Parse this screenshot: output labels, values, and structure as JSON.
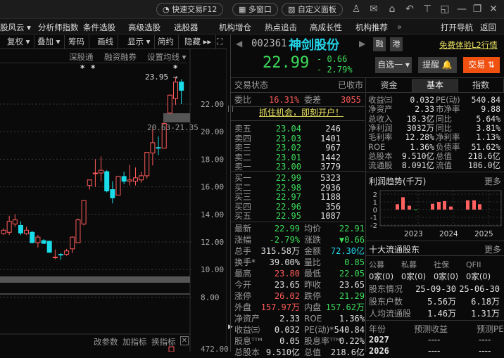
{
  "titlebar": {
    "quick_trade": "快速交易F12",
    "multi_window": "多窗口",
    "custom_panel": "自定义面板"
  },
  "menu": [
    "股风云 ▾",
    "分析师指数",
    "条件选股",
    "高级选股",
    "选股器",
    "机构增仓",
    "热点追击",
    "高成长性",
    "机构推荐",
    "»",
    "打开导航",
    "返回"
  ],
  "toolbar": [
    "复权 ▾",
    "叠加 ▾",
    "筹码",
    "画线",
    "显示 ▾",
    "简约",
    "隐藏 ▸▸"
  ],
  "chart_links": [
    "深股通",
    "融资融券",
    "设置均线 ▾"
  ],
  "chart": {
    "price_ticks": [
      "22.00",
      "20.00",
      "18.00",
      "16.00",
      "14.00",
      "12.00",
      "10.00",
      "8.00"
    ],
    "tick_values": [
      22,
      20,
      18,
      16,
      14,
      12,
      10,
      8
    ],
    "high_label": "23.95 →",
    "range_label": "20.63-21.35",
    "markers": [
      "*",
      "*",
      "*"
    ],
    "candles": [
      [
        12.6,
        12.85,
        13.0,
        12.5
      ],
      [
        12.7,
        13.5,
        13.9,
        12.5
      ],
      [
        13.3,
        13.6,
        14.0,
        13.1
      ],
      [
        13.2,
        12.65,
        13.5,
        12.5
      ],
      [
        12.6,
        12.85,
        13.1,
        12.5
      ],
      [
        12.7,
        11.95,
        12.8,
        11.9
      ],
      [
        11.95,
        12.35,
        12.5,
        11.6
      ],
      [
        12.1,
        11.9,
        12.2,
        11.85
      ],
      [
        12.05,
        11.25,
        12.1,
        11.2
      ],
      [
        10.85,
        10.9,
        11.45,
        10.75
      ],
      [
        11.1,
        11.05,
        11.2,
        10.7
      ],
      [
        11.1,
        11.35,
        11.5,
        11.0
      ],
      [
        11.5,
        12.35,
        12.4,
        11.2
      ],
      [
        11.95,
        13.6,
        13.7,
        11.95
      ],
      [
        13.3,
        15.0,
        15.0,
        13.2
      ],
      [
        16.1,
        16.5,
        16.5,
        15.8
      ],
      [
        16.95,
        17.0,
        18.0,
        16.0
      ],
      [
        17.0,
        17.2,
        18.2,
        16.4
      ],
      [
        17.1,
        15.7,
        17.2,
        15.6
      ],
      [
        15.8,
        15.2,
        16.4,
        14.8
      ],
      [
        15.4,
        16.75,
        16.8,
        15.4
      ],
      [
        16.75,
        16.4,
        17.1,
        16.2
      ],
      [
        16.4,
        16.5,
        17.6,
        16.1
      ],
      [
        16.4,
        16.65,
        17.4,
        16.1
      ],
      [
        16.5,
        16.8,
        17.1,
        16.3
      ],
      [
        16.8,
        18.5,
        18.5,
        16.6
      ],
      [
        18.45,
        19.2,
        20.4,
        17.55
      ],
      [
        18.85,
        18.8,
        19.65,
        18.3
      ],
      [
        18.8,
        20.6,
        20.65,
        18.8
      ],
      [
        21.35,
        22.65,
        22.7,
        21.3
      ],
      [
        22.4,
        23.6,
        23.95,
        21.95
      ],
      [
        23.6,
        23.0,
        23.8,
        22.0
      ]
    ],
    "indicator_actions": [
      "改参数",
      "加指标",
      "换指标"
    ],
    "volume_tick": "472.00"
  },
  "stock": {
    "code": "002361",
    "name": "神剑股份",
    "tag_margin": "融",
    "tag_hk": "港",
    "l2_link": "免费体验L2行情",
    "price": "22.99",
    "change": "- 0.66",
    "change_pct": "- 2.79%",
    "watchlist": "自选一 ▾",
    "alert": "提醒 🔔",
    "trade": "交易 ⇅"
  },
  "status": {
    "label": "交易状态",
    "value": "已收市",
    "ratio_label": "委比",
    "ratio": "16.31%",
    "diff_label": "委差",
    "diff": "3055",
    "promo": "抓住机会，即刻开户！"
  },
  "asks": [
    [
      "卖五",
      "23.04",
      "246"
    ],
    [
      "卖四",
      "23.03",
      "1401"
    ],
    [
      "卖三",
      "23.02",
      "967"
    ],
    [
      "卖二",
      "23.01",
      "1442"
    ],
    [
      "卖一",
      "23.00",
      "3779"
    ]
  ],
  "bids": [
    [
      "买一",
      "22.99",
      "5323"
    ],
    [
      "买二",
      "22.98",
      "2936"
    ],
    [
      "买三",
      "22.97",
      "1188"
    ],
    [
      "买四",
      "22.96",
      "356"
    ],
    [
      "买五",
      "22.95",
      "1087"
    ]
  ],
  "stats": [
    [
      "最新",
      "22.99",
      "g",
      "均价",
      "22.91",
      "g"
    ],
    [
      "涨幅",
      "-2.79%",
      "g",
      "涨跌",
      "▼0.66",
      "g"
    ],
    [
      "总手",
      "315.58万",
      "w",
      "金额",
      "72.30亿",
      "c"
    ],
    [
      "换手*",
      "39.00%",
      "w",
      "量比",
      "0.85",
      "g"
    ],
    [
      "最高",
      "23.80",
      "r",
      "最低",
      "22.05",
      "g"
    ],
    [
      "今开",
      "23.65",
      "w",
      "昨收",
      "23.65",
      "w"
    ],
    [
      "涨停",
      "26.02",
      "r",
      "跌停",
      "21.29",
      "g"
    ],
    [
      "外盘",
      "157.97万",
      "r",
      "内盘",
      "157.62万",
      "g"
    ],
    [
      "净资产",
      "2.33",
      "w",
      "ROE",
      "1.36%",
      "w"
    ],
    [
      "收益㈢",
      "0.032",
      "w",
      "PE(动)*",
      "540.84",
      "w"
    ],
    [
      "股息ᵀᵀᴹ",
      "0.05",
      "w",
      "股息率ᵀᵀᴹ",
      "0.22%",
      "w"
    ],
    [
      "总股本",
      "9.510亿",
      "w",
      "总值",
      "218.6亿",
      "w"
    ]
  ],
  "tabs": [
    "资金",
    "基本",
    "指数"
  ],
  "fund": [
    [
      "收益㈢",
      "0.032",
      "PE(动)",
      "540.84"
    ],
    [
      "净资产",
      "2.33",
      "市净率",
      "9.88"
    ],
    [
      "总收入",
      "18.3亿",
      "同比",
      "5.64%"
    ],
    [
      "净利润",
      "3032万",
      "同比",
      "3.81%"
    ],
    [
      "毛利率",
      "12.28%",
      "净利率",
      "1.13%"
    ],
    [
      "ROE",
      "1.36%",
      "负债率",
      "51.62%"
    ],
    [
      "总股本",
      "9.510亿",
      "总值",
      "218.6亿"
    ],
    [
      "流通股",
      "8.091亿",
      "流值",
      "186.0亿"
    ]
  ],
  "profit": {
    "title": "利润趋势(千万)",
    "more": "更多",
    "y_ticks": [
      "2",
      "1",
      "0",
      "-1",
      "-2"
    ],
    "years": [
      "2023",
      "2024",
      "2025"
    ],
    "values": [
      0.7,
      1.6,
      0.5,
      -0.05,
      0.75,
      1.0,
      1.1,
      0.4,
      1.2,
      1.2,
      0.7
    ],
    "pos_color": "#ff6060",
    "neg_color": "#20c040"
  },
  "holders": {
    "title": "十大流通股东",
    "more": "更多",
    "types": [
      "公募",
      "私募",
      "社保",
      "QFII"
    ],
    "counts": [
      "0家(0)",
      "0家(0)",
      "0家(0)",
      "0家(0)"
    ],
    "rows": [
      [
        "股东情况",
        "25-09-30",
        "25-06-30"
      ],
      [
        "股东户数",
        "5.56万",
        "6.18万"
      ],
      [
        "人均流通股",
        "1.46万",
        "1.31万"
      ]
    ]
  },
  "forecast": {
    "headers": [
      "年份",
      "预测收益",
      "预测PE"
    ],
    "rows": [
      [
        "2027",
        "----",
        "----"
      ],
      [
        "2026",
        "----",
        "----"
      ]
    ]
  }
}
